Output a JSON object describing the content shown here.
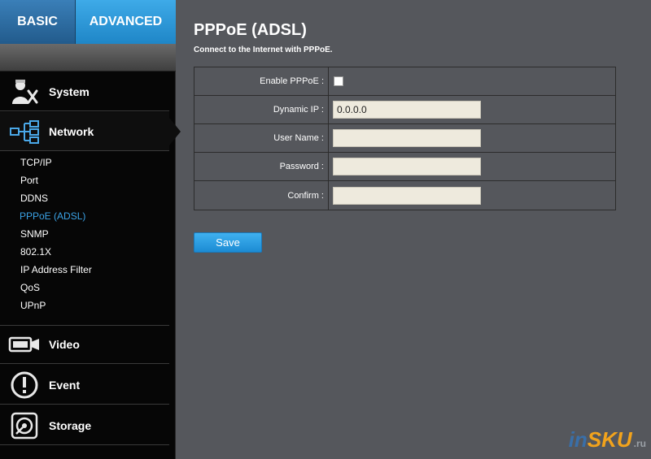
{
  "tabs": {
    "basic": "BASIC",
    "advanced": "ADVANCED"
  },
  "menu": {
    "system": "System",
    "network": "Network",
    "video": "Video",
    "event": "Event",
    "storage": "Storage"
  },
  "network_items": [
    "TCP/IP",
    "Port",
    "DDNS",
    "PPPoE (ADSL)",
    "SNMP",
    "802.1X",
    "IP Address Filter",
    "QoS",
    "UPnP"
  ],
  "active_item": "PPPoE (ADSL)",
  "page": {
    "title": "PPPoE (ADSL)",
    "subtitle": "Connect to the Internet with PPPoE."
  },
  "form": {
    "enable_label": "Enable PPPoE :",
    "enable_checked": false,
    "dynamic_ip_label": "Dynamic IP :",
    "dynamic_ip_value": "0.0.0.0",
    "username_label": "User Name :",
    "username_value": "",
    "password_label": "Password :",
    "password_value": "",
    "confirm_label": "Confirm :",
    "confirm_value": ""
  },
  "save_label": "Save",
  "watermark": {
    "in": "in",
    "sku": "SKU",
    "ru": ".ru"
  },
  "colors": {
    "accent": "#1f86c7",
    "active_link": "#3ba3e6",
    "background": "#55575c"
  }
}
